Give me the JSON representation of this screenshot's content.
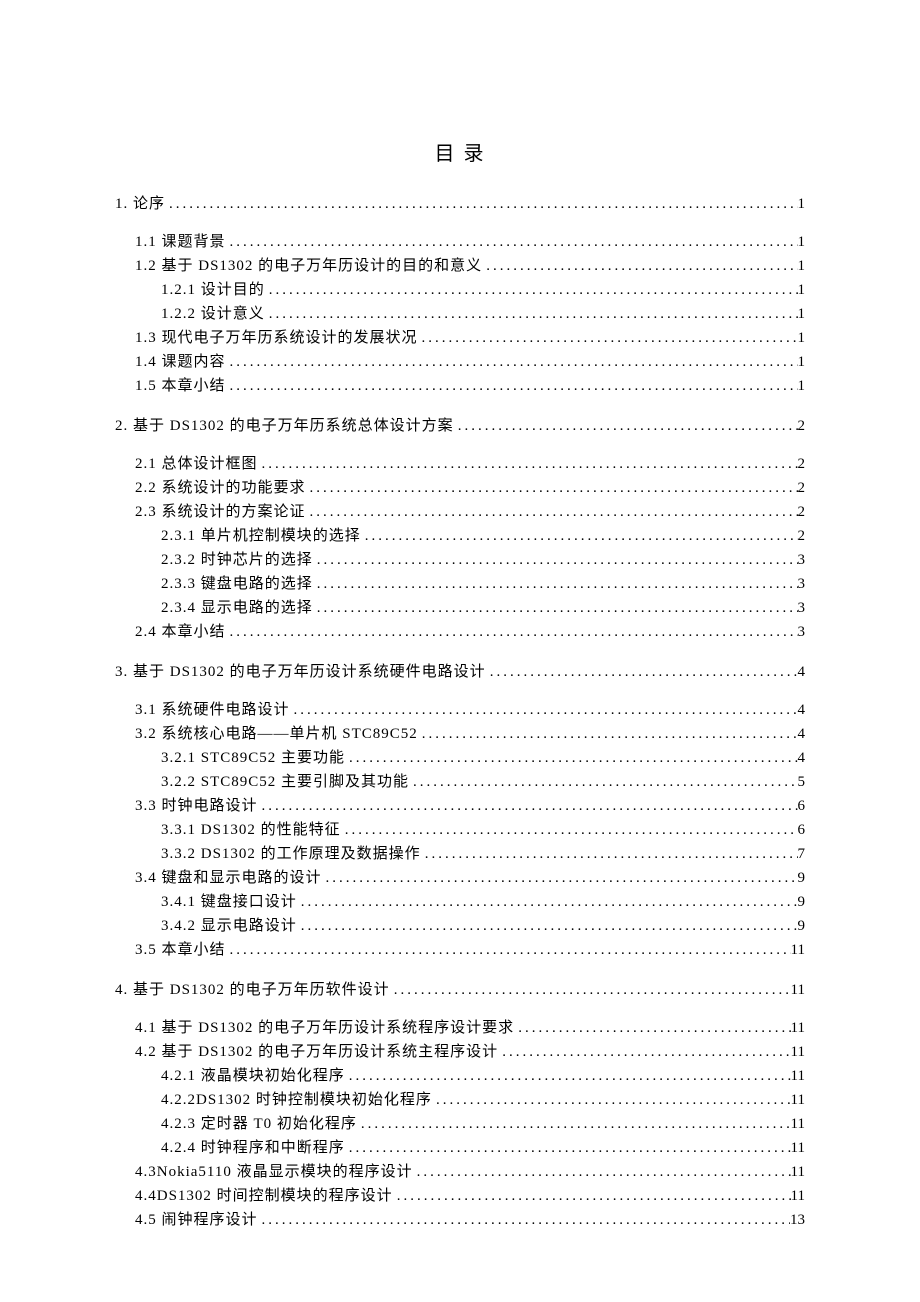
{
  "title": "目 录",
  "toc": [
    {
      "level": 1,
      "label": "1. 论序",
      "page": "1"
    },
    {
      "level": 2,
      "label": "1.1 课题背景",
      "page": "1"
    },
    {
      "level": 2,
      "label": "1.2 基于 DS1302 的电子万年历设计的目的和意义",
      "page": "1"
    },
    {
      "level": 3,
      "label": "1.2.1 设计目的",
      "page": "1"
    },
    {
      "level": 3,
      "label": "1.2.2 设计意义",
      "page": "1"
    },
    {
      "level": 2,
      "label": "1.3 现代电子万年历系统设计的发展状况",
      "page": "1"
    },
    {
      "level": 2,
      "label": "1.4 课题内容",
      "page": "1"
    },
    {
      "level": 2,
      "label": "1.5 本章小结",
      "page": "1"
    },
    {
      "level": 1,
      "label": "2. 基于 DS1302 的电子万年历系统总体设计方案",
      "page": "2"
    },
    {
      "level": 2,
      "label": "2.1 总体设计框图",
      "page": "2"
    },
    {
      "level": 2,
      "label": "2.2 系统设计的功能要求",
      "page": "2"
    },
    {
      "level": 2,
      "label": "2.3 系统设计的方案论证",
      "page": "2"
    },
    {
      "level": 3,
      "label": "2.3.1 单片机控制模块的选择",
      "page": "2"
    },
    {
      "level": 3,
      "label": "2.3.2 时钟芯片的选择",
      "page": "3"
    },
    {
      "level": 3,
      "label": "2.3.3 键盘电路的选择",
      "page": "3"
    },
    {
      "level": 3,
      "label": "2.3.4 显示电路的选择",
      "page": "3"
    },
    {
      "level": 2,
      "label": "2.4 本章小结",
      "page": "3"
    },
    {
      "level": 1,
      "label": "3. 基于 DS1302 的电子万年历设计系统硬件电路设计",
      "page": "4"
    },
    {
      "level": 2,
      "label": "3.1 系统硬件电路设计",
      "page": "4"
    },
    {
      "level": 2,
      "label": "3.2 系统核心电路——单片机 STC89C52",
      "page": "4"
    },
    {
      "level": 3,
      "label": "3.2.1 STC89C52 主要功能",
      "page": "4"
    },
    {
      "level": 3,
      "label": "3.2.2 STC89C52 主要引脚及其功能",
      "page": "5"
    },
    {
      "level": 2,
      "label": "3.3 时钟电路设计",
      "page": "6"
    },
    {
      "level": 3,
      "label": "3.3.1 DS1302 的性能特征",
      "page": "6"
    },
    {
      "level": 3,
      "label": "3.3.2  DS1302 的工作原理及数据操作",
      "page": "7"
    },
    {
      "level": 2,
      "label": "3.4 键盘和显示电路的设计",
      "page": "9"
    },
    {
      "level": 3,
      "label": "3.4.1 键盘接口设计",
      "page": "9"
    },
    {
      "level": 3,
      "label": "3.4.2 显示电路设计",
      "page": "9"
    },
    {
      "level": 2,
      "label": "3.5 本章小结",
      "page": "11"
    },
    {
      "level": 1,
      "label": "4.  基于 DS1302 的电子万年历软件设计",
      "page": "11"
    },
    {
      "level": 2,
      "label": "4.1 基于 DS1302 的电子万年历设计系统程序设计要求",
      "page": "11"
    },
    {
      "level": 2,
      "label": "4.2 基于 DS1302 的电子万年历设计系统主程序设计",
      "page": "11"
    },
    {
      "level": 3,
      "label": "4.2.1 液晶模块初始化程序",
      "page": "11"
    },
    {
      "level": 3,
      "label": "4.2.2DS1302 时钟控制模块初始化程序",
      "page": "11"
    },
    {
      "level": 3,
      "label": "4.2.3 定时器 T0 初始化程序",
      "page": "11"
    },
    {
      "level": 3,
      "label": "4.2.4 时钟程序和中断程序",
      "page": "11"
    },
    {
      "level": 2,
      "label": "4.3Nokia5110 液晶显示模块的程序设计",
      "page": "11"
    },
    {
      "level": 2,
      "label": "4.4DS1302 时间控制模块的程序设计",
      "page": "11"
    },
    {
      "level": 2,
      "label": "4.5 闹钟程序设计",
      "page": "13"
    }
  ]
}
